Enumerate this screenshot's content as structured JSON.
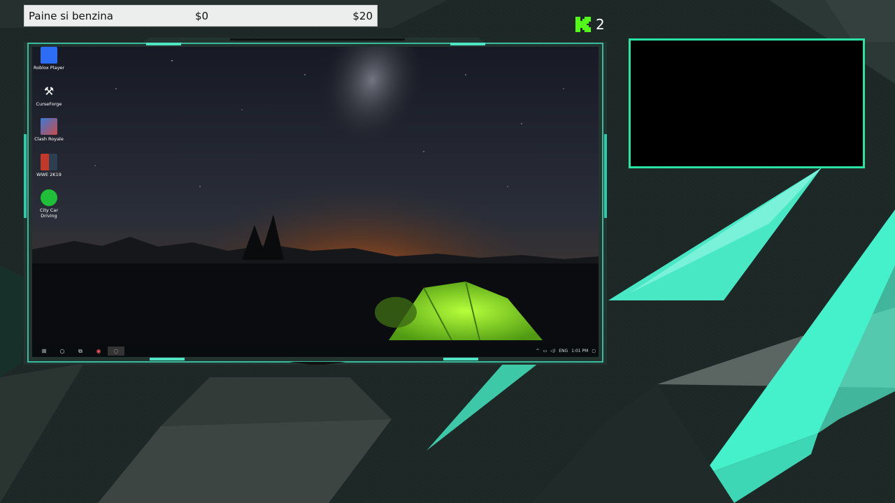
{
  "overlay": {
    "goal": {
      "title": "Paine si benzina",
      "current": "$0",
      "target": "$20",
      "progress_percent": 0
    },
    "kick": {
      "icon": "kick-logo-icon",
      "viewer_count": "2",
      "accent": "#53fc18"
    },
    "webcam": {
      "border_color": "#29e3a4"
    },
    "theme": {
      "background": "#1c2624",
      "accent": "#3fe8c0"
    }
  },
  "desktop": {
    "icons": [
      {
        "label": "Roblox Player",
        "icon": "roblox-icon"
      },
      {
        "label": "CurseForge",
        "icon": "curseforge-icon"
      },
      {
        "label": "Clash Royale",
        "icon": "clash-royale-icon"
      },
      {
        "label": "WWE 2K19",
        "icon": "wwe-icon"
      },
      {
        "label": "City Car Driving",
        "icon": "city-car-driving-icon"
      }
    ],
    "taskbar": {
      "items": [
        "start-icon",
        "search-icon",
        "task-view-icon",
        "browser-icon",
        "app-icon"
      ],
      "language": "ENG",
      "time": "1:01 PM"
    }
  }
}
